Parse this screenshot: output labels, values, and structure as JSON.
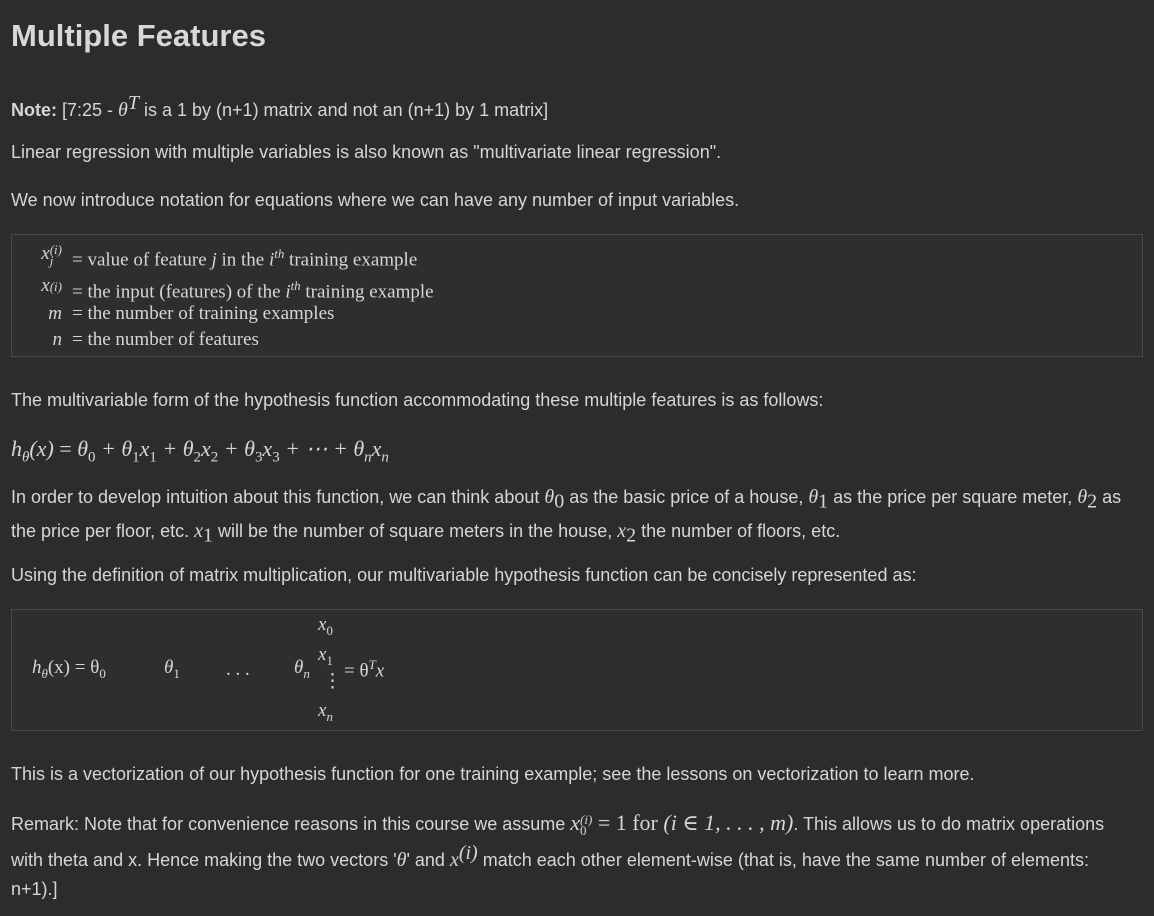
{
  "title": "Multiple Features",
  "note": {
    "bold": "Note:",
    "pre": "[7:25 - ",
    "theta": "θ",
    "sup": "T",
    "post": " is a 1 by (n+1) matrix and not an (n+1) by 1 matrix]"
  },
  "para1": "Linear regression with multiple variables is also known as \"multivariate linear regression\".",
  "para2": "We now introduce notation for equations where we can have any number of input variables.",
  "definitions": [
    {
      "sym": "x",
      "sub": "j",
      "sup": "(i)",
      "eq": "=",
      "pre": "value of feature ",
      "var": "j",
      "mid": " in the ",
      "var2": "i",
      "sup2": "th",
      "post": " training example"
    },
    {
      "sym": "x",
      "sub": "",
      "sup": "(i)",
      "eq": "=",
      "pre": "the input (features) of the ",
      "var": "",
      "mid": "",
      "var2": "i",
      "sup2": "th",
      "post": " training example"
    },
    {
      "sym": "m",
      "sub": "",
      "sup": "",
      "eq": "=",
      "pre": "the number of training examples",
      "var": "",
      "mid": "",
      "var2": "",
      "sup2": "",
      "post": ""
    },
    {
      "sym": "n",
      "sub": "",
      "sup": "",
      "eq": "=",
      "pre": "the number of features",
      "var": "",
      "mid": "",
      "var2": "",
      "sup2": "",
      "post": ""
    }
  ],
  "para3": "The multivariable form of the hypothesis function accommodating these multiple features is as follows:",
  "hypothesis": {
    "h": "h",
    "hsub": "θ",
    "x": "(x)",
    "eq": " = ",
    "terms": [
      "θ",
      "0",
      " + θ",
      "1",
      "x",
      "1",
      " + θ",
      "2",
      "x",
      "2",
      " + θ",
      "3",
      "x",
      "3",
      " + ⋯ + θ",
      "n",
      "x",
      "n"
    ]
  },
  "para4": {
    "a": "In order to develop intuition about this function, we can think about ",
    "t0": "θ",
    "t0s": "0",
    "b": " as the basic price of a house, ",
    "t1": "θ",
    "t1s": "1",
    "c": " as the price per square meter, ",
    "t2": "θ",
    "t2s": "2",
    "d": " as",
    "e": "the price per floor, etc. ",
    "x1": "x",
    "x1s": "1",
    "f": " will be the number of square meters in the house, ",
    "x2": "x",
    "x2s": "2",
    "g": " the number of floors, etc."
  },
  "para5": "Using the definition of matrix multiplication, our multivariable hypothesis function can be concisely represented as:",
  "matrix_eq": {
    "lhs_h": "h",
    "lhs_sub": "θ",
    "lhs_x": "(x) = θ",
    "lhs_0": "0",
    "theta1": "θ",
    "theta1_sub": "1",
    "dots": ". . .",
    "thetan": "θ",
    "thetan_sub": "n",
    "x0": "x",
    "x0_sub": "0",
    "x1": "x",
    "x1_sub": "1",
    "vdots": "⋮",
    "xn": "x",
    "xn_sub": "n",
    "rhs": "= θ",
    "rhs_sup": "T",
    "rhs_x": "x"
  },
  "para6": "This is a vectorization of our hypothesis function for one training example; see the lessons on vectorization to learn more.",
  "remark": {
    "a": "Remark: Note that for convenience reasons in this course we assume ",
    "x": "x",
    "xsup": "(i)",
    "xsub": "0",
    "eq": " = 1 for ",
    "range": "(i ∈ 1, . . . , m)",
    "b": ". This allows us to do matrix operations",
    "c": "with theta and x. Hence making the two vectors '",
    "theta": "θ",
    "d": "' and ",
    "x2": "x",
    "x2sup": "(i)",
    "e": " match each other element-wise (that is, have the same number of elements:",
    "f": "n+1).]"
  }
}
